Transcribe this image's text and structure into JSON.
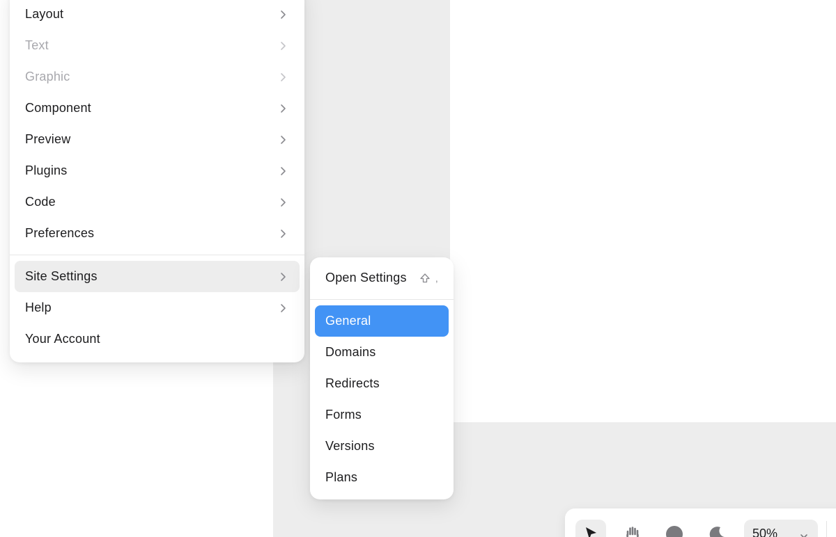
{
  "main_menu": {
    "items": [
      {
        "label": "Layout",
        "disabled": false,
        "submenu": true
      },
      {
        "label": "Text",
        "disabled": true,
        "submenu": true
      },
      {
        "label": "Graphic",
        "disabled": true,
        "submenu": true
      },
      {
        "label": "Component",
        "disabled": false,
        "submenu": true
      },
      {
        "label": "Preview",
        "disabled": false,
        "submenu": true
      },
      {
        "label": "Plugins",
        "disabled": false,
        "submenu": true
      },
      {
        "label": "Code",
        "disabled": false,
        "submenu": true
      },
      {
        "label": "Preferences",
        "disabled": false,
        "submenu": true
      }
    ],
    "secondary_items": [
      {
        "label": "Site Settings",
        "active": true,
        "submenu": true
      },
      {
        "label": "Help",
        "active": false,
        "submenu": true
      },
      {
        "label": "Your Account",
        "active": false,
        "submenu": false
      }
    ]
  },
  "site_settings_submenu": {
    "open_settings": {
      "label": "Open Settings",
      "shortcut_key": ","
    },
    "items": [
      {
        "label": "General",
        "selected": true
      },
      {
        "label": "Domains",
        "selected": false
      },
      {
        "label": "Redirects",
        "selected": false
      },
      {
        "label": "Forms",
        "selected": false
      },
      {
        "label": "Versions",
        "selected": false
      },
      {
        "label": "Plans",
        "selected": false
      }
    ]
  },
  "toolbar": {
    "tools": [
      "pointer-icon",
      "hand-icon",
      "circle-icon",
      "moon-icon"
    ],
    "zoom_value": "50%"
  },
  "colors": {
    "selected_item": "#4293f5",
    "hover_item": "#ededed",
    "canvas_gray": "#ededed",
    "disabled_text": "#a8a8ad"
  }
}
